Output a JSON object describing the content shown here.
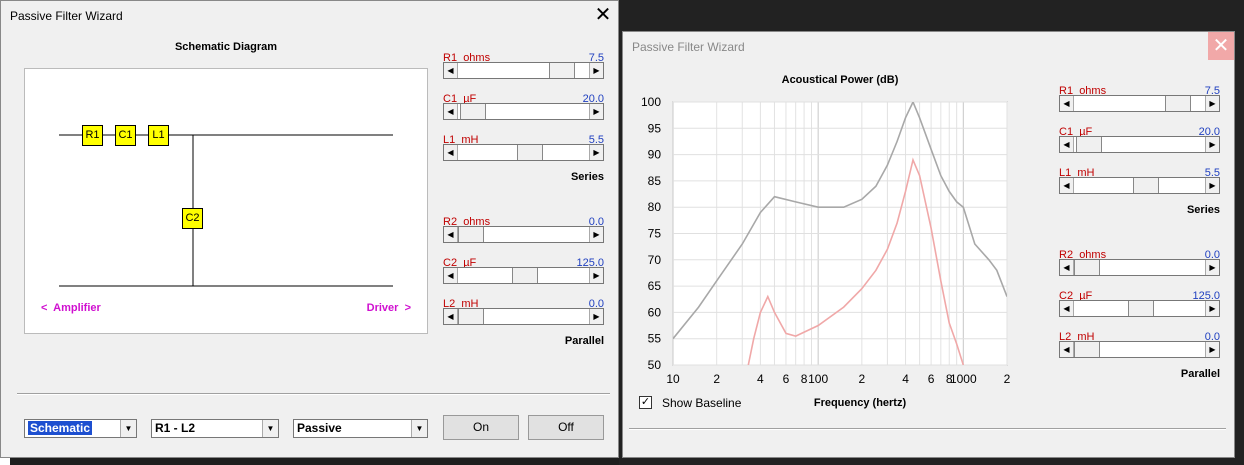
{
  "left_window": {
    "title": "Passive Filter Wizard",
    "close_icon": "close-icon",
    "schematic_title": "Schematic Diagram",
    "components": {
      "r1": "R1",
      "c1": "C1",
      "l1": "L1",
      "c2": "C2"
    },
    "amplifier_label": "<  Amplifier",
    "driver_label": "Driver  >",
    "series_params": [
      {
        "name": "R1",
        "unit": "ohms",
        "value": "7.5",
        "level": 0.85
      },
      {
        "name": "C1",
        "unit": "µF",
        "value": "20.0",
        "level": 0.02
      },
      {
        "name": "L1",
        "unit": "mH",
        "value": "5.5",
        "level": 0.55
      }
    ],
    "series_label": "Series",
    "parallel_params": [
      {
        "name": "R2",
        "unit": "ohms",
        "value": "0.0",
        "level": 0.0
      },
      {
        "name": "C2",
        "unit": "µF",
        "value": "125.0",
        "level": 0.5
      },
      {
        "name": "L2",
        "unit": "mH",
        "value": "0.0",
        "level": 0.0
      }
    ],
    "parallel_label": "Parallel",
    "view_select": "Schematic",
    "range_select": "R1 - L2",
    "type_select": "Passive",
    "on_button": "On",
    "off_button": "Off"
  },
  "right_window": {
    "title": "Passive Filter Wizard",
    "close_icon": "close-icon",
    "show_baseline_label": "Show Baseline",
    "show_baseline_checked": true,
    "series_params": [
      {
        "name": "R1",
        "unit": "ohms",
        "value": "7.5",
        "level": 0.85
      },
      {
        "name": "C1",
        "unit": "µF",
        "value": "20.0",
        "level": 0.02
      },
      {
        "name": "L1",
        "unit": "mH",
        "value": "5.5",
        "level": 0.55
      }
    ],
    "series_label": "Series",
    "parallel_params": [
      {
        "name": "R2",
        "unit": "ohms",
        "value": "0.0",
        "level": 0.0
      },
      {
        "name": "C2",
        "unit": "µF",
        "value": "125.0",
        "level": 0.5
      },
      {
        "name": "L2",
        "unit": "mH",
        "value": "0.0",
        "level": 0.0
      }
    ],
    "parallel_label": "Parallel"
  },
  "chart_data": {
    "type": "line",
    "title": "Acoustical Power (dB)",
    "xlabel": "Frequency (hertz)",
    "ylabel": "",
    "x_scale": "log",
    "xlim": [
      10,
      2000
    ],
    "ylim": [
      50,
      100
    ],
    "x_tick_labels": [
      "10",
      "2",
      "4",
      "6",
      "8",
      "100",
      "2",
      "4",
      "6",
      "8",
      "1000",
      "2"
    ],
    "y_tick_labels": [
      "100",
      "95",
      "90",
      "85",
      "80",
      "75",
      "70",
      "65",
      "60",
      "55",
      "50"
    ],
    "grid": true,
    "series": [
      {
        "color": "#a8a8a8",
        "x": [
          10,
          15,
          20,
          30,
          40,
          50,
          70,
          100,
          150,
          200,
          250,
          300,
          350,
          400,
          450,
          500,
          600,
          700,
          800,
          900,
          1000,
          1200,
          1500,
          1700,
          2000
        ],
        "y": [
          55,
          61,
          66,
          73,
          79,
          82,
          81,
          80,
          80,
          81.5,
          84,
          88,
          92.5,
          97,
          100,
          97,
          91,
          86,
          83,
          81,
          80,
          73,
          70,
          68,
          63
        ]
      },
      {
        "color": "#f0a8a8",
        "x": [
          33,
          36,
          40,
          45,
          50,
          60,
          70,
          100,
          150,
          200,
          250,
          300,
          350,
          400,
          450,
          500,
          600,
          700,
          800,
          900,
          1000
        ],
        "y": [
          50,
          55,
          60,
          63,
          60,
          56,
          55.5,
          57.5,
          61,
          64.5,
          68,
          72,
          77,
          83,
          89,
          86,
          76,
          66,
          58,
          54,
          50
        ]
      }
    ]
  }
}
